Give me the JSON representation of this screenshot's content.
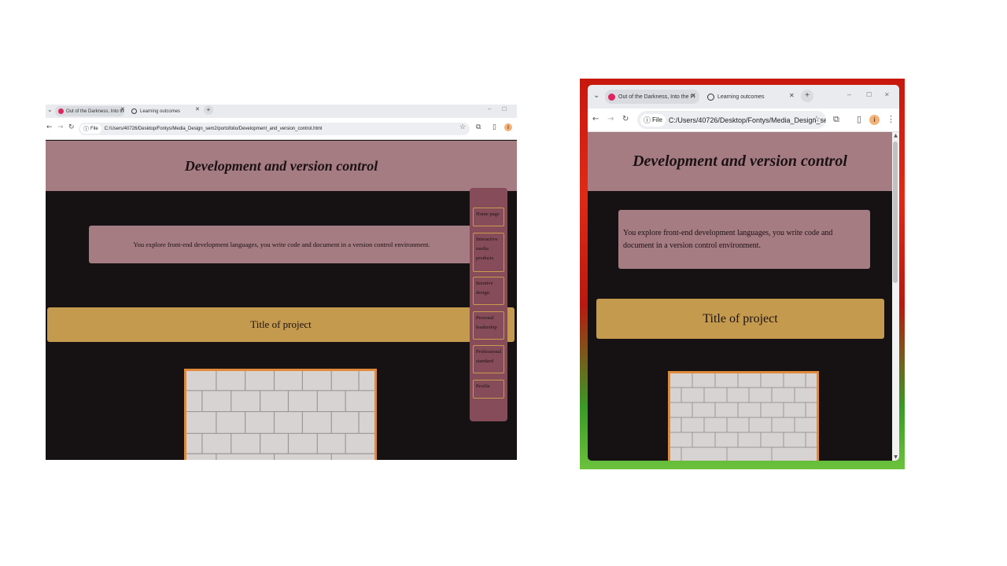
{
  "browser": {
    "tabs": [
      {
        "title": "Out of the Darkness, Into the Fi",
        "favicon": "youtube-icon",
        "active": false
      },
      {
        "title": "Learning outcomes",
        "favicon": "globe-icon",
        "active": true
      }
    ],
    "new_tab_label": "+",
    "file_chip": "File",
    "address_full": "C:/Users/40726/Desktop/Fontys/Media_Design_sem2/portofolio/Development_and_version_control.html",
    "address_short": "C:/Users/40726/Desktop/Fontys/Media_Design_sem2/p...",
    "profile_initial": "i",
    "window_controls": {
      "minimize": "–",
      "maximize": "☐",
      "close": "✕"
    }
  },
  "page": {
    "title": "Development and version control",
    "intro": "You explore front-end development languages, you write code and document in a version control environment.",
    "project_title": "Title of project"
  },
  "sidenav": {
    "items": [
      {
        "label": "Home page"
      },
      {
        "label": "Interactive media products"
      },
      {
        "label": "Iterative design"
      },
      {
        "label": "Personal leadership"
      },
      {
        "label": "Professional standard"
      },
      {
        "label": "Profile"
      }
    ]
  },
  "colors": {
    "header_bg": "#a67c83",
    "page_bg": "#161214",
    "project_bar": "#c49a4e",
    "sidenav_bg": "#864c59",
    "image_border": "#e08a3a"
  },
  "icons": [
    "tab-search-icon",
    "youtube-icon",
    "globe-icon",
    "back-icon",
    "forward-icon",
    "reload-icon",
    "info-icon",
    "star-icon",
    "extensions-icon",
    "sidepanel-icon",
    "more-icon"
  ]
}
